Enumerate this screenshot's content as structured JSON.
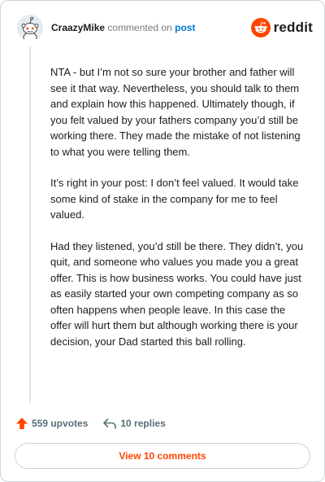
{
  "header": {
    "username": "CraazyMike",
    "commented_text": "commented on",
    "post_link": "post",
    "brand": "reddit"
  },
  "comment": {
    "paragraphs": [
      "NTA - but I’m not so sure your brother and father will see it that way. Nevertheless, you should talk to them and explain how this happened. Ultimately though, if you felt valued by your fathers company you’d still be working there. They made the mistake of not listening to what you were telling them.",
      "It’s right in your post: I don’t feel valued. It would take some kind of stake in the company for me to feel valued.",
      "Had they listened, you’d still be there. They didn’t, you quit, and someone who values you made you a great offer. This is how business works. You could have just as easily started your own competing company as so often happens when people leave. In this case the offer will hurt them but although working there is your decision, your Dad started this ball rolling."
    ]
  },
  "actions": {
    "upvotes": "559 upvotes",
    "replies": "10 replies"
  },
  "view_button": "View 10 comments",
  "colors": {
    "accent": "#ff4500",
    "link": "#0079d3",
    "muted": "#576f76"
  },
  "icons": {
    "avatar": "snoo-avatar-icon",
    "brand": "reddit-logo-icon",
    "upvote": "upvote-arrow-icon",
    "reply": "reply-arrow-icon"
  }
}
